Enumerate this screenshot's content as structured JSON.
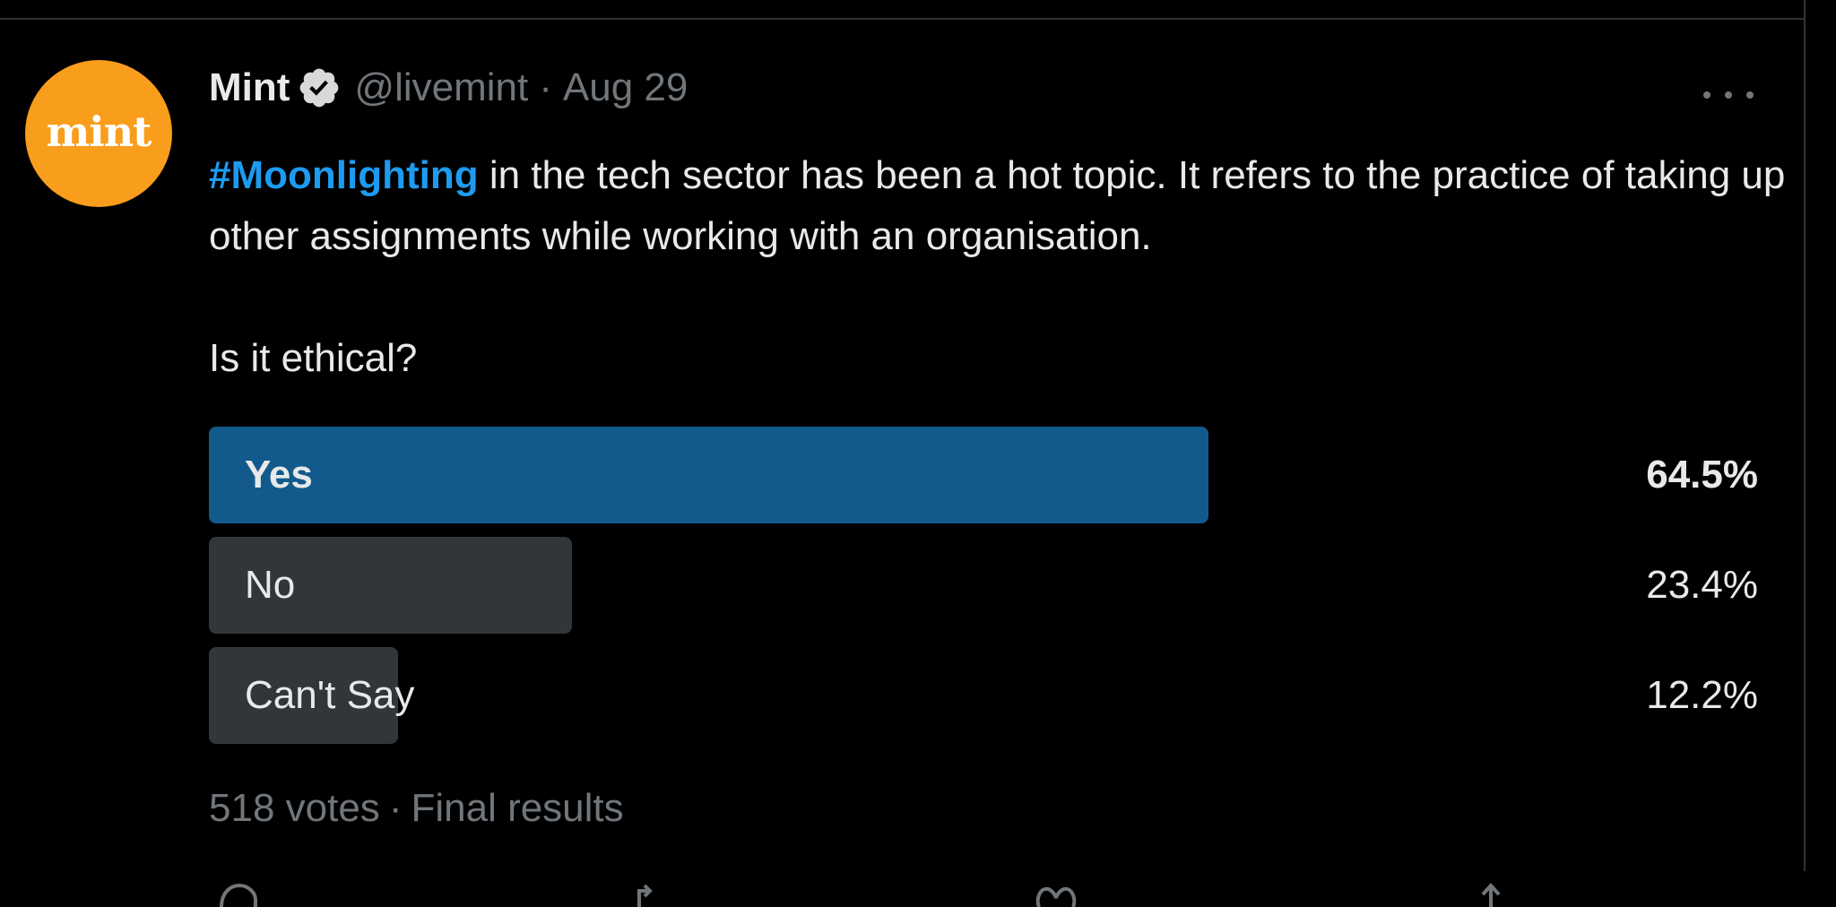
{
  "tweet": {
    "avatar_text": "mint",
    "display_name": "Mint",
    "handle": "@livemint",
    "separator": "·",
    "date": "Aug 29",
    "text_hashtag": "#Moonlighting",
    "text_body": " in the tech sector has been a hot topic. It refers to the practice of taking up other assignments while working with an organisation.",
    "question": "Is it ethical?"
  },
  "poll": {
    "options": [
      {
        "label": "Yes",
        "percent_label": "64.5%",
        "percent": 64.5,
        "winner": true
      },
      {
        "label": "No",
        "percent_label": "23.4%",
        "percent": 23.4,
        "winner": false
      },
      {
        "label": "Can't Say",
        "percent_label": "12.2%",
        "percent": 12.2,
        "winner": false
      }
    ],
    "votes": "518 votes",
    "separator": "·",
    "status": "Final results"
  },
  "colors": {
    "background": "#000000",
    "text": "#e7e9ea",
    "muted": "#71767b",
    "link": "#1d9bf0",
    "winner_bar": "#135a8c",
    "bar": "#333639",
    "avatar": "#f99d1c"
  },
  "icons": {
    "verified": "verified-badge-icon",
    "more": "more-options-icon",
    "reply": "reply-icon",
    "retweet": "retweet-icon",
    "like": "like-icon",
    "share": "share-icon"
  }
}
